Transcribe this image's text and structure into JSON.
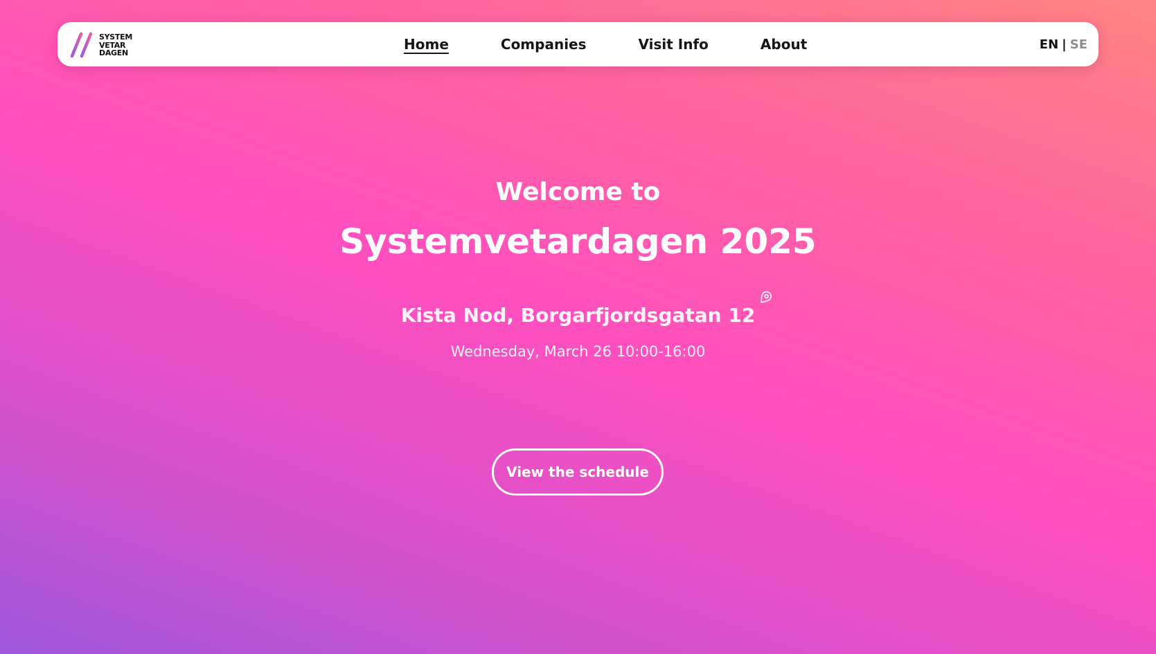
{
  "logo": {
    "lines": [
      "SYSTEM",
      "VETAR",
      "DAGEN"
    ],
    "colors": [
      "#9c5ce0",
      "#e3609e"
    ]
  },
  "nav": {
    "items": [
      {
        "label": "Home",
        "active": true
      },
      {
        "label": "Companies",
        "active": false
      },
      {
        "label": "Visit Info",
        "active": false
      },
      {
        "label": "About",
        "active": false
      }
    ],
    "lang": {
      "en": "EN",
      "separator": "|",
      "se": "SE",
      "selected": "EN"
    }
  },
  "hero": {
    "welcome": "Welcome to",
    "title": "Systemvetardagen 2025",
    "location": "Kista Nod, Borgarfjordsgatan 12",
    "location_icon": "location-pin-icon",
    "datetime": "Wednesday, March 26 10:00-16:00",
    "cta": "View the schedule"
  },
  "colors": {
    "gradient_purple": "#9e57dc",
    "gradient_pink": "#ff4fbf",
    "gradient_coral": "#ff8482",
    "text": "#ffffff",
    "nav_text": "#151515",
    "lang_inactive": "#8d8d8d"
  }
}
